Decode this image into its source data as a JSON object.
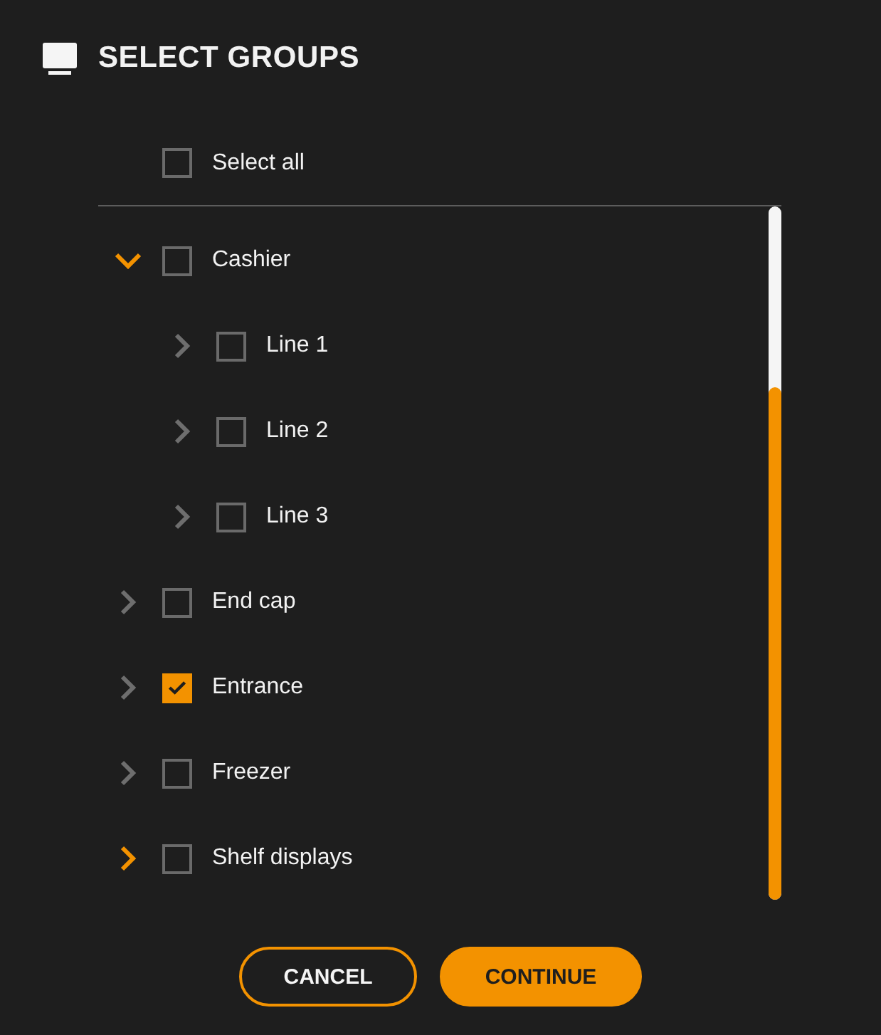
{
  "header": {
    "title": "SELECT GROUPS"
  },
  "select_all": {
    "label": "Select all",
    "checked": false
  },
  "groups": [
    {
      "label": "Cashier",
      "checked": false,
      "expanded": true,
      "highlighted": true,
      "children": [
        {
          "label": "Line 1",
          "checked": false,
          "expanded": false,
          "highlighted": false
        },
        {
          "label": "Line 2",
          "checked": false,
          "expanded": false,
          "highlighted": false
        },
        {
          "label": "Line 3",
          "checked": false,
          "expanded": false,
          "highlighted": false
        }
      ]
    },
    {
      "label": "End cap",
      "checked": false,
      "expanded": false,
      "highlighted": false
    },
    {
      "label": "Entrance",
      "checked": true,
      "expanded": false,
      "highlighted": false
    },
    {
      "label": "Freezer",
      "checked": false,
      "expanded": false,
      "highlighted": false
    },
    {
      "label": "Shelf displays",
      "checked": false,
      "expanded": false,
      "highlighted": true
    }
  ],
  "buttons": [
    {
      "label": "CANCEL",
      "kind": "secondary"
    },
    {
      "label": "CONTINUE",
      "kind": "primary"
    }
  ]
}
